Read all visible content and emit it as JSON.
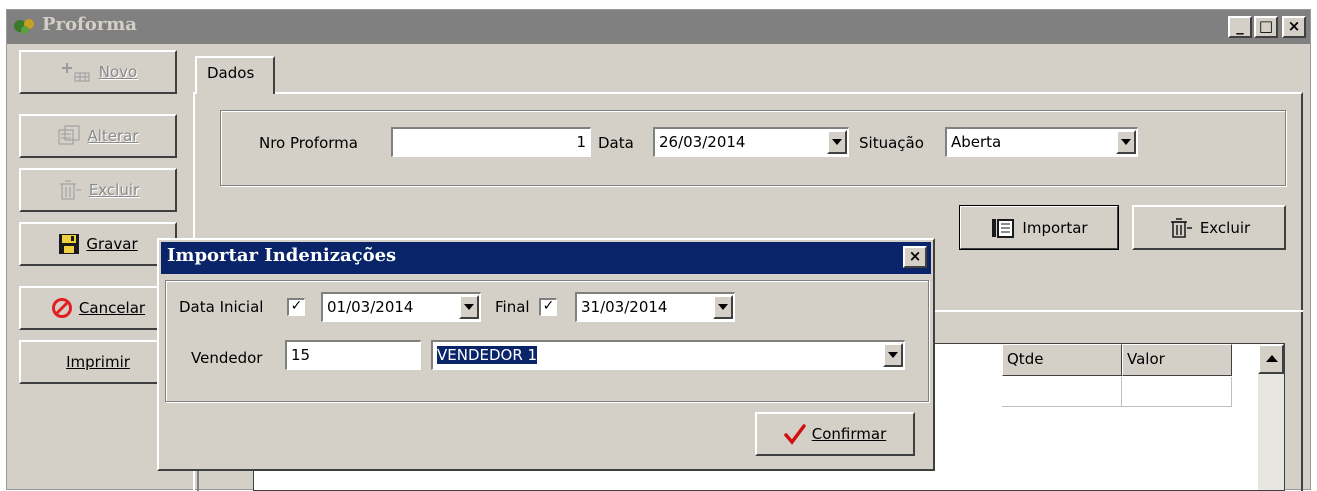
{
  "window": {
    "title": "Proforma",
    "minimize_glyph": "_",
    "maximize_glyph": "□",
    "close_glyph": "×"
  },
  "sidebar": {
    "novo_label": "Novo",
    "alterar_label": "Alterar",
    "excluir_label": "Excluir",
    "gravar_label": "Gravar",
    "cancelar_label": "Cancelar",
    "imprimir_label": "Imprimir"
  },
  "tabs": {
    "dados_label": "Dados"
  },
  "header": {
    "nro_label": "Nro Proforma",
    "nro_value": "1",
    "data_label": "Data",
    "data_value": "26/03/2014",
    "situacao_label": "Situação",
    "situacao_value": "Aberta"
  },
  "actions": {
    "importar_label": "Importar",
    "excluir_label": "Excluir"
  },
  "grid": {
    "columns": [
      "Qtde",
      "Valor"
    ]
  },
  "dialog": {
    "title": "Importar Indenizações",
    "close_glyph": "×",
    "data_inicial_label": "Data Inicial",
    "data_inicial_value": "01/03/2014",
    "final_label": "Final",
    "final_value": "31/03/2014",
    "check_glyph": "✓",
    "vendedor_label": "Vendedor",
    "vendedor_code": "15",
    "vendedor_name": "VENDEDOR 1",
    "confirmar_label": "Confirmar"
  },
  "colors": {
    "window_bg": "#d4d0c8",
    "active_title": "#0a246a",
    "inactive_title": "#808080",
    "cancel_red": "#e02020",
    "confirm_red": "#d01010"
  }
}
